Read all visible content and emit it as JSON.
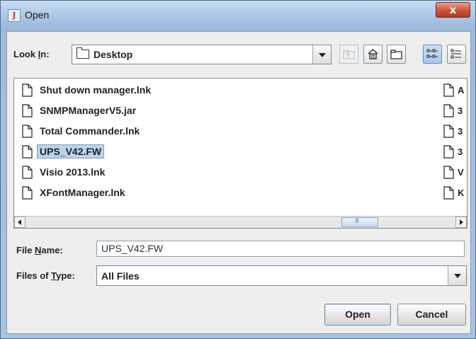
{
  "window": {
    "title": "Open",
    "close_symbol": "x"
  },
  "look_in": {
    "label_prefix": "Look ",
    "label_mnemonic": "I",
    "label_suffix": "n:",
    "value": "Desktop"
  },
  "toolbar": {
    "icons": [
      "up-folder-icon",
      "home-icon",
      "new-folder-icon",
      "list-view-icon",
      "details-view-icon"
    ]
  },
  "files": {
    "items": [
      {
        "name": "Shut down manager.lnk",
        "selected": false,
        "col2": "A"
      },
      {
        "name": "SNMPManagerV5.jar",
        "selected": false,
        "col2": "3"
      },
      {
        "name": "Total Commander.lnk",
        "selected": false,
        "col2": "3"
      },
      {
        "name": "UPS_V42.FW",
        "selected": true,
        "col2": "3"
      },
      {
        "name": "Visio 2013.lnk",
        "selected": false,
        "col2": "V"
      },
      {
        "name": "XFontManager.lnk",
        "selected": false,
        "col2": "K"
      }
    ]
  },
  "file_name": {
    "label_prefix": "File ",
    "label_mnemonic": "N",
    "label_suffix": "ame:",
    "value": "UPS_V42.FW"
  },
  "file_type": {
    "label_prefix": "Files of ",
    "label_mnemonic": "T",
    "label_suffix": "ype:",
    "value": "All Files"
  },
  "buttons": {
    "open": "Open",
    "cancel": "Cancel"
  },
  "colors": {
    "selection": "#bcd3ea",
    "titlebar": "#a8c4e3",
    "close": "#c9472c"
  }
}
